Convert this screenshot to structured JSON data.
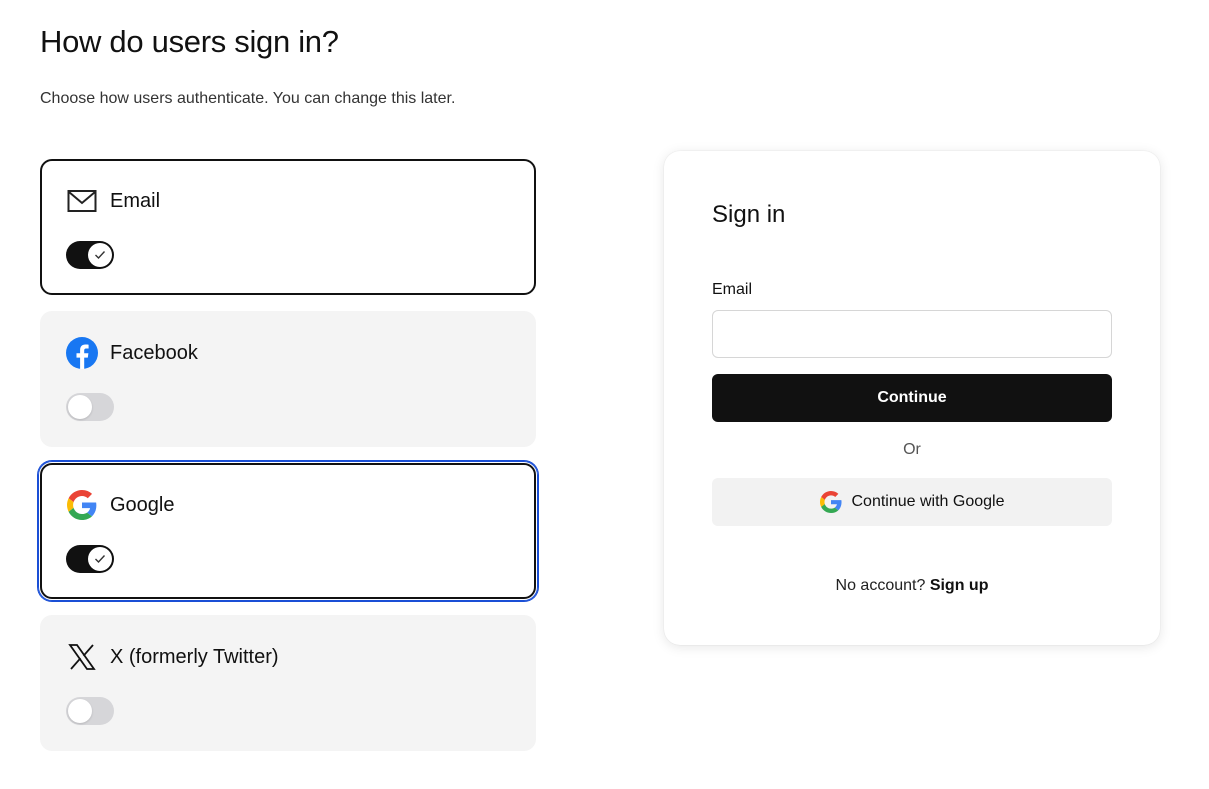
{
  "header": {
    "title": "How do users sign in?",
    "subtitle": "Choose how users authenticate. You can change this later."
  },
  "providers": [
    {
      "label": "Email",
      "icon": "mail-icon",
      "enabled": true
    },
    {
      "label": "Facebook",
      "icon": "facebook-icon",
      "enabled": false
    },
    {
      "label": "Google",
      "icon": "google-icon",
      "enabled": true
    },
    {
      "label": "X (formerly Twitter)",
      "icon": "x-icon",
      "enabled": false
    }
  ],
  "preview": {
    "title": "Sign in",
    "email_label": "Email",
    "email_value": "",
    "continue_label": "Continue",
    "or_label": "Or",
    "google_label": "Continue with Google",
    "no_account_text": "No account?",
    "signup_label": "Sign up"
  },
  "colors": {
    "accent": "#111111",
    "focus_ring": "#1a4fd6",
    "facebook_blue": "#1877f2",
    "card_inactive_bg": "#f4f4f4"
  }
}
